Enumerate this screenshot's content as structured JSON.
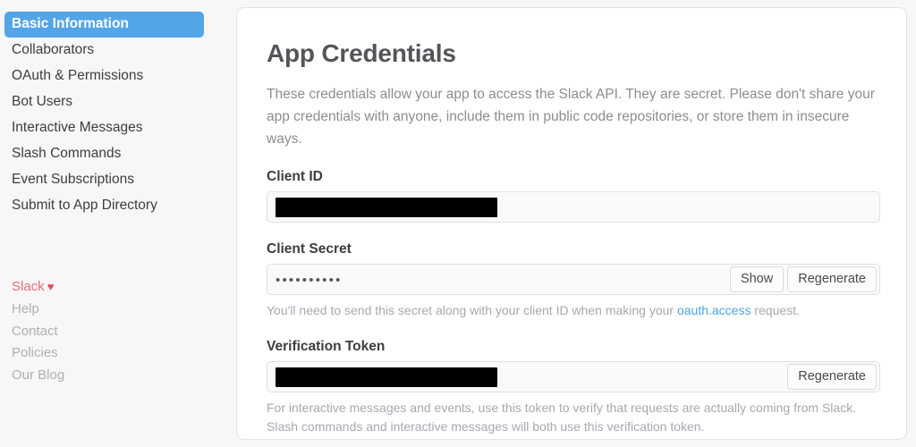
{
  "sidebar": {
    "nav_items": [
      {
        "label": "Basic Information",
        "active": true
      },
      {
        "label": "Collaborators",
        "active": false
      },
      {
        "label": "OAuth & Permissions",
        "active": false
      },
      {
        "label": "Bot Users",
        "active": false
      },
      {
        "label": "Interactive Messages",
        "active": false
      },
      {
        "label": "Slash Commands",
        "active": false
      },
      {
        "label": "Event Subscriptions",
        "active": false
      },
      {
        "label": "Submit to App Directory",
        "active": false
      }
    ],
    "footer": {
      "brand": "Slack",
      "heart": "♥",
      "links": [
        "Help",
        "Contact",
        "Policies",
        "Our Blog"
      ]
    },
    "active_color": "#54a5e8",
    "brand_color": "#e8707a"
  },
  "main": {
    "title": "App Credentials",
    "description": "These credentials allow your app to access the Slack API. They are secret. Please don't share your app credentials with anyone, include them in public code repositories, or store them in insecure ways.",
    "client_id": {
      "label": "Client ID",
      "value": "",
      "redacted": true
    },
    "client_secret": {
      "label": "Client Secret",
      "value": "••••••••••",
      "show_button": "Show",
      "regenerate_button": "Regenerate",
      "helper_prefix": "You'll need to send this secret along with your client ID when making your ",
      "helper_link": "oauth.access",
      "helper_suffix": " request."
    },
    "verification_token": {
      "label": "Verification Token",
      "value": "",
      "redacted": true,
      "regenerate_button": "Regenerate",
      "helper_line1": "For interactive messages and events, use this token to verify that requests are actually coming from Slack.",
      "helper_line2": "Slash commands and interactive messages will both use this verification token."
    },
    "link_color": "#4da3e8"
  }
}
